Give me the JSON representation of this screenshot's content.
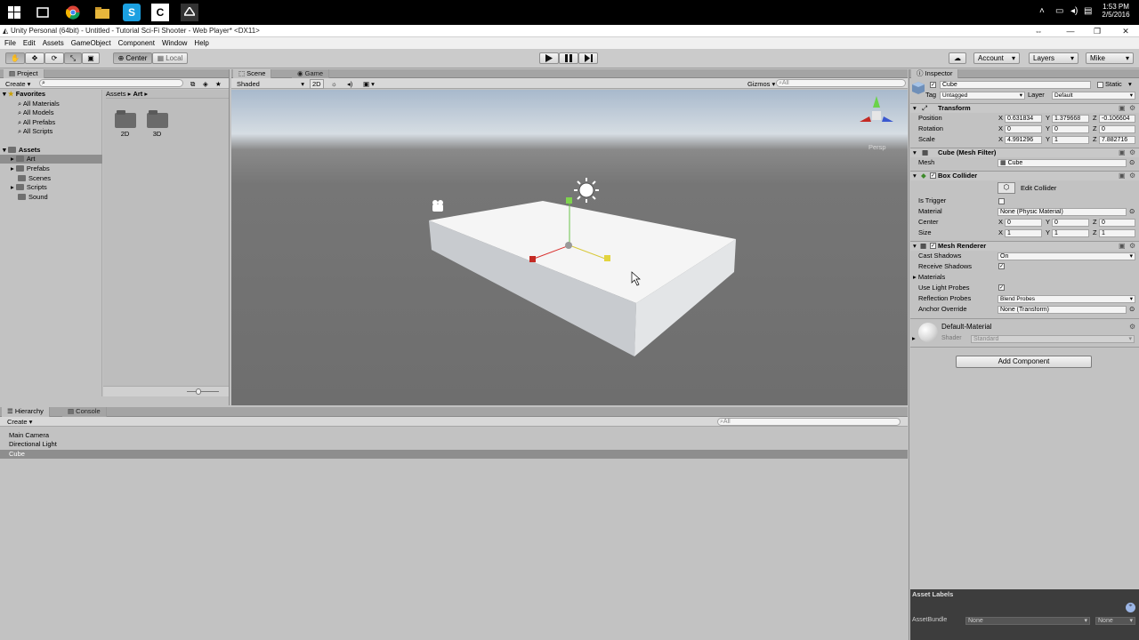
{
  "taskbar": {
    "clock_time": "1:53 PM",
    "clock_date": "2/5/2016"
  },
  "window": {
    "title": "Unity Personal (64bit) - Untitled - Tutorial Sci-Fi Shooter - Web Player* <DX11>"
  },
  "menu": [
    "File",
    "Edit",
    "Assets",
    "GameObject",
    "Component",
    "Window",
    "Help"
  ],
  "toolbar": {
    "pivot_center": "Center",
    "pivot_local": "Local",
    "account": "Account",
    "layers": "Layers",
    "user": "Mike"
  },
  "project": {
    "tab": "Project",
    "create": "Create",
    "favorites_label": "Favorites",
    "favorites": [
      "All Materials",
      "All Models",
      "All Prefabs",
      "All Scripts"
    ],
    "assets_label": "Assets",
    "assets": [
      "Art",
      "Prefabs",
      "Scenes",
      "Scripts",
      "Sound"
    ],
    "breadcrumb_root": "Assets",
    "breadcrumb_current": "Art",
    "folders": [
      "2D",
      "3D"
    ]
  },
  "scene": {
    "tab_scene": "Scene",
    "tab_game": "Game",
    "shading": "Shaded",
    "mode_2d": "2D",
    "gizmos": "Gizmos",
    "search_all": "All",
    "persp": "Persp"
  },
  "hierarchy": {
    "tab": "Hierarchy",
    "console_tab": "Console",
    "create": "Create",
    "search_all": "All",
    "items": [
      "Main Camera",
      "Directional Light",
      "Cube"
    ]
  },
  "inspector": {
    "tab": "Inspector",
    "object_name": "Cube",
    "static_label": "Static",
    "tag_label": "Tag",
    "tag_value": "Untagged",
    "layer_label": "Layer",
    "layer_value": "Default",
    "transform": {
      "title": "Transform",
      "position_label": "Position",
      "rotation_label": "Rotation",
      "scale_label": "Scale",
      "position": [
        "0.631834",
        "1.379668",
        "-0.106604"
      ],
      "rotation": [
        "0",
        "0",
        "0"
      ],
      "scale": [
        "4.991296",
        "1",
        "7.882716"
      ]
    },
    "mesh_filter": {
      "title": "Cube (Mesh Filter)",
      "mesh_label": "Mesh",
      "mesh_value": "Cube"
    },
    "box_collider": {
      "title": "Box Collider",
      "edit_label": "Edit Collider",
      "is_trigger_label": "Is Trigger",
      "material_label": "Material",
      "material_value": "None (Physic Material)",
      "center_label": "Center",
      "center": [
        "0",
        "0",
        "0"
      ],
      "size_label": "Size",
      "size": [
        "1",
        "1",
        "1"
      ]
    },
    "mesh_renderer": {
      "title": "Mesh Renderer",
      "cast_shadows_label": "Cast Shadows",
      "cast_shadows_value": "On",
      "receive_shadows_label": "Receive Shadows",
      "materials_label": "Materials",
      "light_probes_label": "Use Light Probes",
      "reflection_probes_label": "Reflection Probes",
      "reflection_probes_value": "Blend Probes",
      "anchor_override_label": "Anchor Override",
      "anchor_override_value": "None (Transform)"
    },
    "material": {
      "name": "Default-Material",
      "shader_label": "Shader",
      "shader_value": "Standard"
    },
    "add_component": "Add Component",
    "asset_labels": "Asset Labels",
    "asset_bundle_label": "AssetBundle",
    "asset_bundle_value": "None",
    "asset_bundle_variant": "None"
  }
}
